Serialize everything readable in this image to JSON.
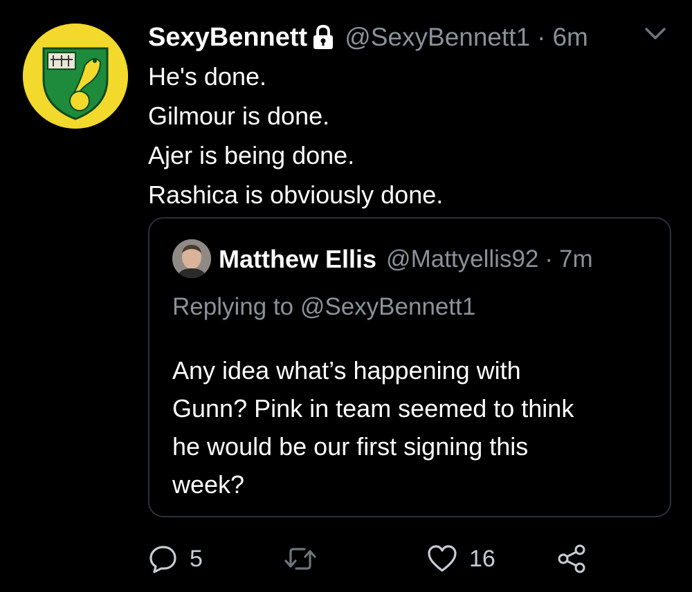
{
  "tweet": {
    "display_name": "SexyBennett",
    "handle": "@SexyBennett1",
    "separator": "·",
    "time": "6m",
    "lines": [
      "He's done.",
      "Gilmour is done.",
      "Ajer is being done.",
      "Rashica is obviously done."
    ],
    "icons": {
      "avatar": "norwich-crest-avatar",
      "lock": "lock-icon",
      "menu": "chevron-down-icon"
    }
  },
  "quoted": {
    "display_name": "Matthew Ellis",
    "handle": "@Mattyellis92",
    "separator": "·",
    "time": "7m",
    "replying_prefix": "Replying to",
    "replying_to": "@SexyBennett1",
    "lines": [
      "Any idea what’s happening with",
      "Gunn? Pink in team seemed to think",
      "he would be our first signing this",
      "week?"
    ]
  },
  "actions": {
    "reply_count": "5",
    "retweet_count": "",
    "like_count": "16",
    "icons": [
      "reply-icon",
      "retweet-icon",
      "like-icon",
      "share-icon"
    ]
  },
  "colors": {
    "background": "#000000",
    "primary_text": "#ffffff",
    "secondary_text": "#8a9199",
    "border": "#2c3237",
    "avatar_yellow": "#f2d92b",
    "crest_green": "#1e8a3c"
  }
}
